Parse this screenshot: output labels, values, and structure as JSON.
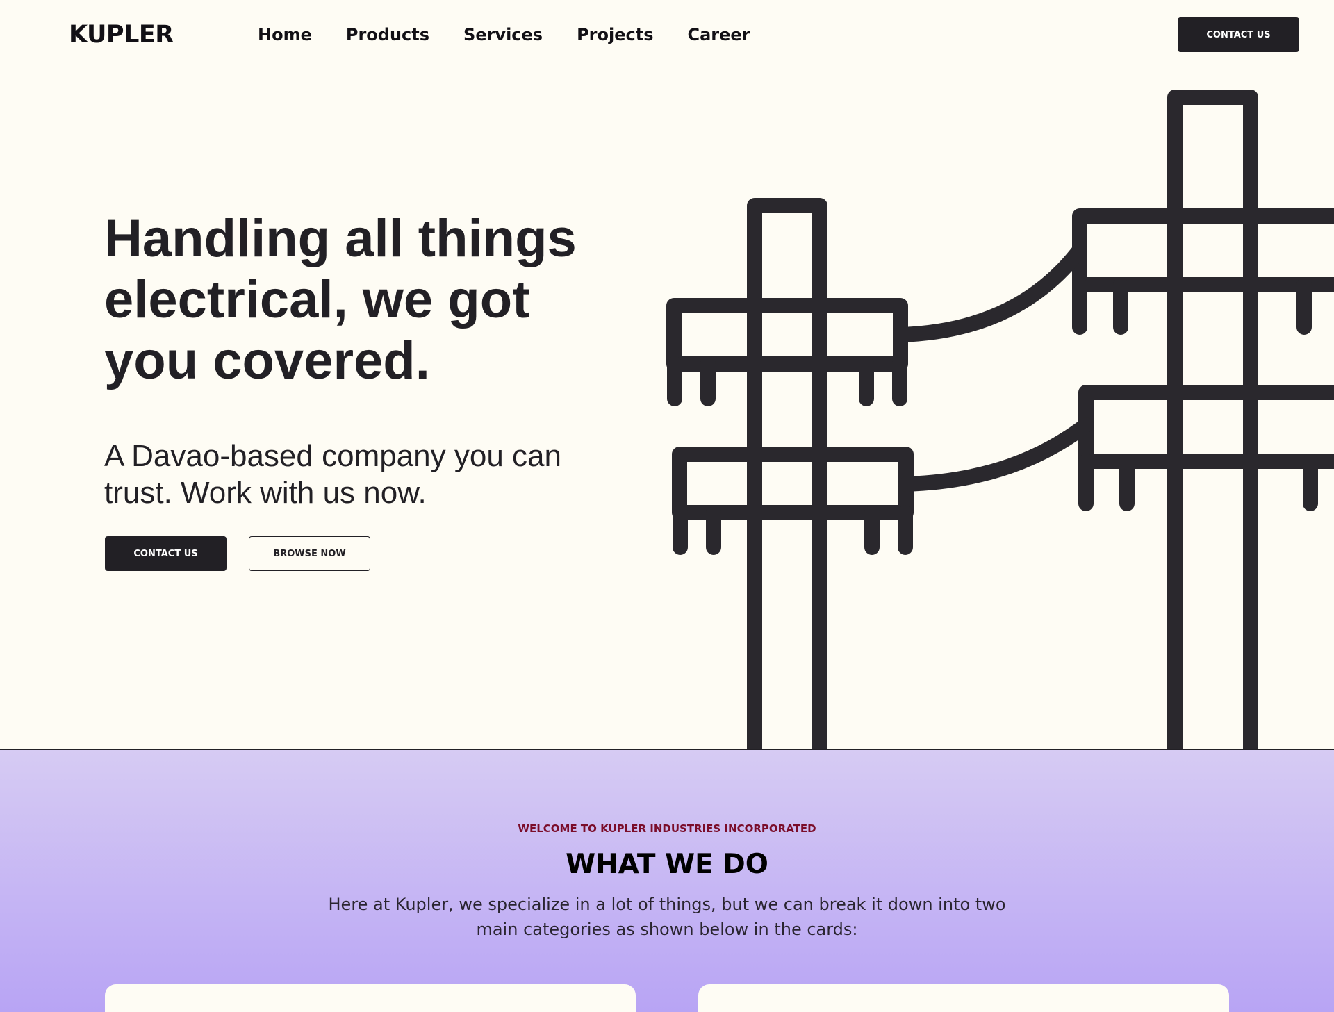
{
  "header": {
    "logo": "KUPLER",
    "nav": [
      "Home",
      "Products",
      "Services",
      "Projects",
      "Career"
    ],
    "contact_label": "CONTACT US"
  },
  "hero": {
    "title": "Handling all things electrical, we got you covered.",
    "subtitle": "A Davao-based company you can trust. Work with us now.",
    "primary_button": "CONTACT US",
    "secondary_button": "BROWSE NOW"
  },
  "what_we_do": {
    "eyebrow": "WELCOME TO KUPLER INDUSTRIES INCORPORATED",
    "title": "WHAT WE DO",
    "description": "Here at Kupler, we specialize in a lot of things, but we can break it down into two main categories as shown below in the cards:"
  },
  "colors": {
    "background": "#fefcf4",
    "ink": "#222025",
    "eyebrow": "#7b0d2a",
    "section_top": "#d6cbf3",
    "section_bottom": "#b8a4f4"
  },
  "icons": {
    "illustration": "utility-poles-illustration"
  }
}
